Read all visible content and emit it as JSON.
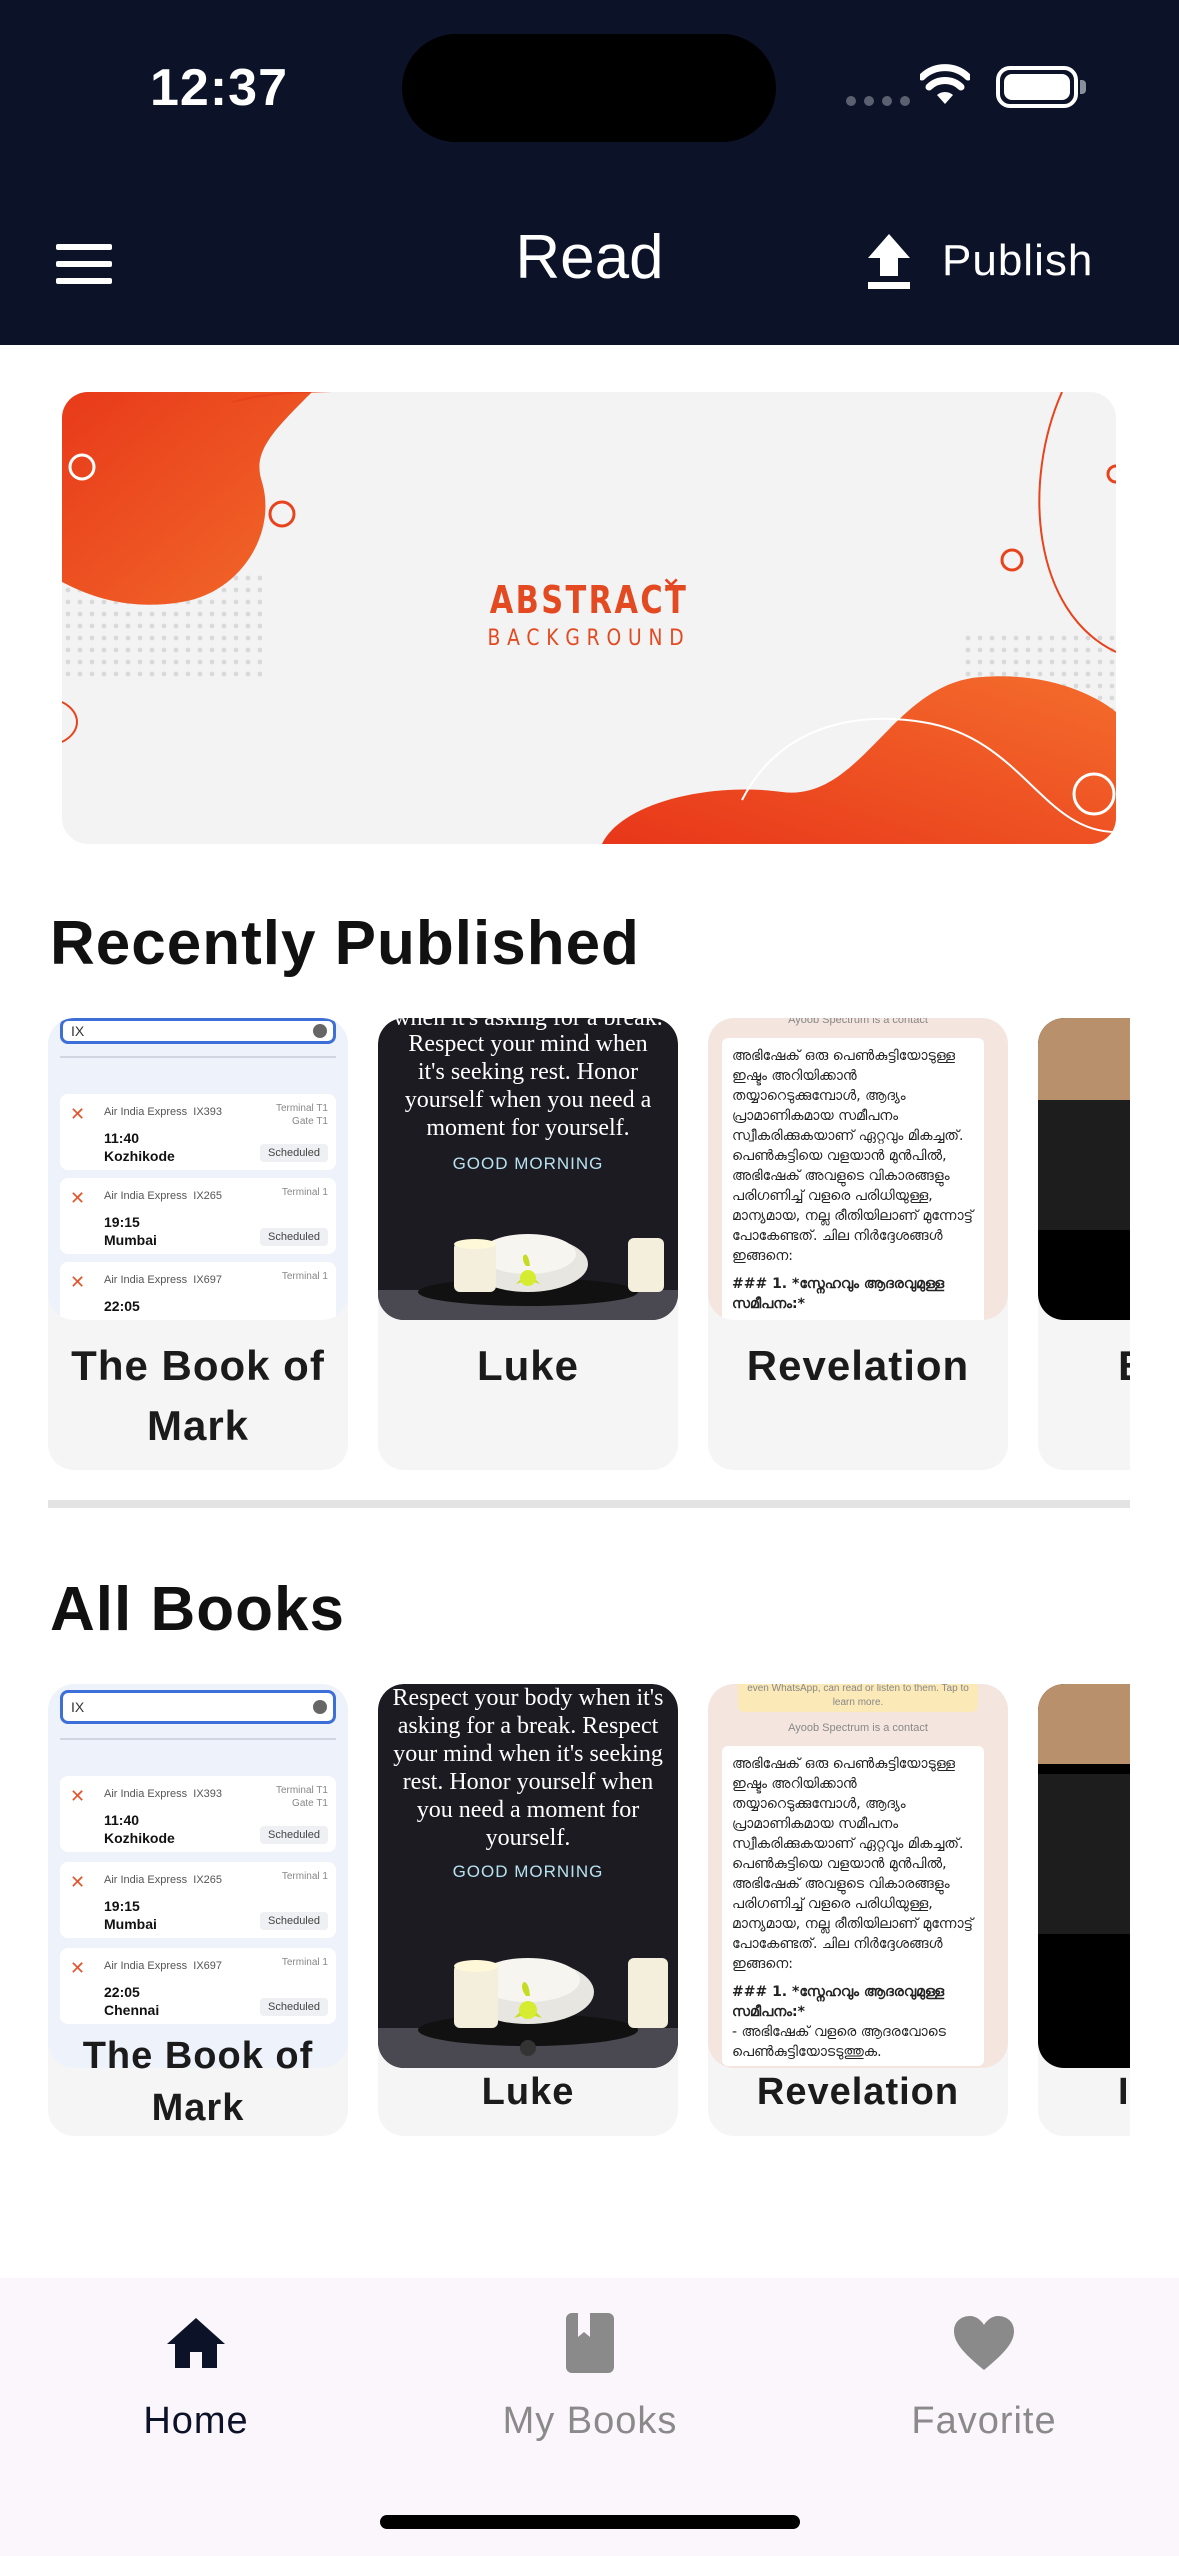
{
  "status_bar": {
    "time": "12:37"
  },
  "header": {
    "title": "Read",
    "publish_label": "Publish"
  },
  "banner": {
    "title": "ABSTRACT",
    "subtitle": "BACKGROUND",
    "accent_color": "#e8431d"
  },
  "sections": {
    "recent": {
      "title": "Recently Published",
      "books": [
        {
          "title_line1": "The Book of",
          "title_line2": "Mark",
          "cover": "flight-list"
        },
        {
          "title_line1": "Luke",
          "cover": "good-morning-poster"
        },
        {
          "title_line1": "Revelation",
          "cover": "malayalam-text"
        },
        {
          "title_line1": "E",
          "cover": "dark-video"
        }
      ]
    },
    "all": {
      "title": "All Books",
      "books": [
        {
          "title_line1": "The Book of",
          "title_line2": "Mark",
          "cover": "flight-list"
        },
        {
          "title_line1": "Luke",
          "cover": "good-morning-poster"
        },
        {
          "title_line1": "Revelation",
          "cover": "malayalam-text"
        },
        {
          "title_line1": "I",
          "cover": "dark-video"
        }
      ]
    }
  },
  "thumbs": {
    "flight": {
      "search": "IX",
      "airline": "Air India Express",
      "flights": [
        {
          "code": "IX393",
          "term": "Terminal T1",
          "gate": "Gate T1",
          "time": "11:40",
          "city": "Kozhikode",
          "status": "Scheduled"
        },
        {
          "code": "IX265",
          "term": "Terminal 1",
          "time": "19:15",
          "city": "Mumbai",
          "status": "Scheduled"
        },
        {
          "code": "IX697",
          "term": "Terminal 1",
          "time": "22:05",
          "city": "Chennai",
          "status": "Scheduled"
        }
      ]
    },
    "poster": {
      "line_top_partial": "when it's asking for a break.",
      "line_top_full": "Respect your body when it's asking for a break.",
      "lines": "Respect your mind when it's seeking rest. Honor yourself when you need a moment for yourself.",
      "greeting": "GOOD MORNING"
    },
    "text": {
      "header_top": "even WhatsApp, can read or listen to them. Tap to learn more.",
      "header": "Ayoob Spectrum is a contact",
      "body": "അഭിഷേക് ഒരു പെൺകുട്ടിയോടുള്ള ഇഷ്ടം അറിയിക്കാൻ തയ്യാറെടുക്കുമ്പോൾ, ആദ്യം പ്രാമാണികമായ സമീപനം സ്വീകരിക്കുകയാണ് ഏറ്റവും മികച്ചത്. പെൺകുട്ടിയെ വളയാൻ മുൻപിൽ, അഭിഷേക് അവളുടെ വികാരങ്ങളും പരിഗണിച്ച് വളരെ പരിധിയുള്ള, മാന്യമായ, നല്ല രീതിയിലാണ് മുന്നോട്ട് പോകേണ്ടത്. ചില നിർദ്ദേശങ്ങൾ ഇങ്ങനെ:",
      "heading": "### 1. *സ്നേഹവും ആദരവുമുള്ള സമീപനം:*",
      "bullet": "- അഭിഷേക് വളരെ ആദരവോടെ പെൺകുട്ടിയോടടുത്തുക."
    }
  },
  "bottom_nav": {
    "items": [
      {
        "label": "Home",
        "icon": "home-icon",
        "active": true
      },
      {
        "label": "My Books",
        "icon": "book-icon",
        "active": false
      },
      {
        "label": "Favorite",
        "icon": "heart-icon",
        "active": false
      }
    ],
    "active_color": "#0c1228",
    "inactive_color": "#8a8a8a"
  }
}
